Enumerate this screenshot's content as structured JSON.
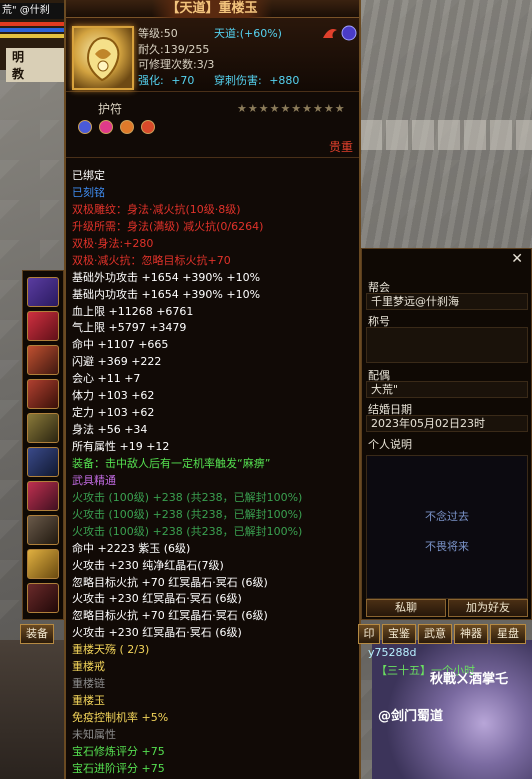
{
  "top_left": {
    "player_name": "荒\" @什刹",
    "faction": "明 教"
  },
  "tooltip": {
    "title": "【天道】重楼玉",
    "level": "等级:50",
    "tiandao": "天道:(+60%)",
    "durability": "耐久:139/255",
    "repair": "可修理次数:3/3",
    "enhance_label": "强化:",
    "enhance_value": "+70",
    "pierce_label": "穿刺伤害:",
    "pierce_value": "+880",
    "amulet_label": "护符",
    "stars": "★★★★★★★★★★",
    "noble": "贵重",
    "lines": [
      {
        "t": "已绑定",
        "c": "#ffffff"
      },
      {
        "t": "已刻铭",
        "c": "#3f8cf0"
      },
      {
        "t": "双极雕纹：身法·减火抗(10级·8级)",
        "c": "#e0322a"
      },
      {
        "t": "升级所需：身法(满级)  减火抗(0/6264)",
        "c": "#e0322a"
      },
      {
        "t": "双极·身法:+280",
        "c": "#e0322a"
      },
      {
        "t": "双极·减火抗：忽略目标火抗+70",
        "c": "#e0322a"
      },
      {
        "t": "基础外功攻击 +1654 +390% +10%",
        "c": "#ffffff",
        "extra": " +390% +10%"
      },
      {
        "t": "基础内功攻击 +1654 +390% +10%",
        "c": "#ffffff"
      },
      {
        "t": "血上限 +11268 +6761",
        "c": "#ffffff"
      },
      {
        "t": "气上限 +5797 +3479",
        "c": "#ffffff"
      },
      {
        "t": "命中 +1107 +665",
        "c": "#ffffff"
      },
      {
        "t": "闪避 +369 +222",
        "c": "#ffffff"
      },
      {
        "t": "会心 +11 +7",
        "c": "#ffffff"
      },
      {
        "t": "体力 +103 +62",
        "c": "#ffffff"
      },
      {
        "t": "定力 +103 +62",
        "c": "#ffffff"
      },
      {
        "t": "身法 +56 +34",
        "c": "#ffffff"
      },
      {
        "t": "所有属性 +19 +12",
        "c": "#ffffff"
      },
      {
        "t": "装备：击中敌人后有一定机率触发“麻痹”",
        "c": "#55e050"
      },
      {
        "t": "武具精通",
        "c": "#c06ae0"
      },
      {
        "t": "火攻击 (100级) +238 (共238，已解封100%)",
        "c": "#3aa050"
      },
      {
        "t": "火攻击 (100级) +238 (共238，已解封100%)",
        "c": "#3aa050"
      },
      {
        "t": "火攻击 (100级) +238 (共238，已解封100%)",
        "c": "#3aa050"
      },
      {
        "t": "命中 +2223 紫玉 (6级)",
        "c": "#ffffff"
      },
      {
        "t": "火攻击 +230 纯净红晶石(7级)",
        "c": "#ffffff"
      },
      {
        "t": "忽略目标火抗 +70 红冥晶石·冥石 (6级)",
        "c": "#ffffff"
      },
      {
        "t": "火攻击 +230 红冥晶石·冥石 (6级)",
        "c": "#ffffff"
      },
      {
        "t": "忽略目标火抗 +70 红冥晶石·冥石 (6级)",
        "c": "#ffffff"
      },
      {
        "t": "火攻击 +230 红冥晶石·冥石 (6级)",
        "c": "#ffffff"
      },
      {
        "t": "重楼天殇 ( 2/3)",
        "c": "#f2d45a"
      },
      {
        "t": "重楼戒",
        "c": "#f2d45a"
      },
      {
        "t": "重楼链",
        "c": "#8c8c8c"
      },
      {
        "t": "重楼玉",
        "c": "#f2d45a"
      },
      {
        "t": "免疫控制机率 +5%",
        "c": "#f2d45a"
      },
      {
        "t": "未知属性",
        "c": "#8c8c8c"
      },
      {
        "t": "宝石修炼评分 +75",
        "c": "#55e050"
      },
      {
        "t": "宝石进阶评分 +75",
        "c": "#55e050"
      }
    ]
  },
  "info_panel": {
    "guild_label": "帮会",
    "guild_value": "千里梦远@什刹海",
    "title_label": "称号",
    "title_value": "",
    "spouse_label": "配偶",
    "spouse_value": "大荒\"",
    "wedding_label": "结婚日期",
    "wedding_value": "2023年05月02日23时",
    "bio_label": "个人说明",
    "bio_line1": "不念过去",
    "bio_line2": "不畏将来",
    "btn_chat": "私聊",
    "btn_friend": "加为好友"
  },
  "tabs": [
    "印",
    "宝鉴",
    "武意",
    "神器",
    "星盘"
  ],
  "equip_tab": "装备",
  "chat": {
    "line1": "y75288d",
    "line2": "【三十五】一个小时",
    "line3": "秋戰ㄨ酒掌乇",
    "line4": "@剑门蜀道"
  }
}
